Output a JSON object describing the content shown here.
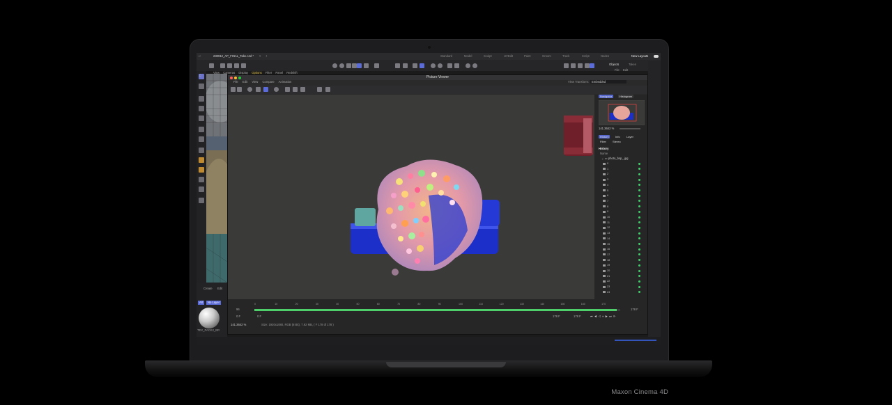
{
  "caption": "Maxon Cinema 4D",
  "app": {
    "file_tab": "230912_AP_FINAL_Take.c4d *",
    "close_tab": "×",
    "add_tab": "+",
    "layouts": [
      "Standard",
      "Model",
      "Sculpt",
      "UVEdit",
      "Paint",
      "Groom",
      "Track",
      "Script",
      "Nodes"
    ],
    "new_layouts": "New Layouts",
    "viewport_menu": [
      "View",
      "Cameras",
      "Display",
      "Options",
      "Filter",
      "Panel",
      "Redshift"
    ],
    "objects_tabs": [
      "Objects",
      "Takes"
    ],
    "objects_menu": [
      "File",
      "Edit"
    ],
    "mat_menu": [
      "Create",
      "Edit"
    ],
    "mat_filters": [
      "All",
      "No Layer"
    ],
    "mat_name": "TEX_PACK2_BR"
  },
  "picture_viewer": {
    "title": "Picture Viewer",
    "menu": [
      "File",
      "Edit",
      "View",
      "Compare",
      "Animation"
    ],
    "view_transform_label": "View Transform:",
    "view_transform_value": "Embedded",
    "nav_tabs": [
      "Navigator",
      "Histogram"
    ],
    "zoom": "141.3642 %",
    "info_tabs": [
      "History",
      "Info",
      "Layer"
    ],
    "sub_tabs": [
      "Filter",
      "Stereo"
    ],
    "history_title": "History",
    "name_header": "Name",
    "folder_name": "photo_bsp_.jpg",
    "history_items": [
      "0",
      "1",
      "2",
      "3",
      "4",
      "5",
      "6",
      "7",
      "8",
      "9",
      "10",
      "11",
      "12",
      "13",
      "14",
      "15",
      "16",
      "17",
      "18",
      "19",
      "20",
      "21",
      "22",
      "23",
      "24"
    ],
    "ticks": [
      "0",
      "10",
      "20",
      "30",
      "40",
      "50",
      "60",
      "70",
      "80",
      "90",
      "100",
      "110",
      "120",
      "130",
      "140",
      "150",
      "160",
      "170"
    ],
    "frame_start": "0 F",
    "frame_field": "96",
    "frame_end": "178 F",
    "frame_current": "178 F",
    "frame_total": "178 F",
    "frame_right": "178 F",
    "timeline_progress": 0.99,
    "status_zoom": "141.3642 %",
    "status_info": "Size: 1920x1080, RGB (8 Bit), 7.92 MB, ( F 178 of 178 )"
  },
  "colors": {
    "accent": "#5b6bd8",
    "green": "#3fd16a",
    "active_menu": "#e2c24a"
  }
}
